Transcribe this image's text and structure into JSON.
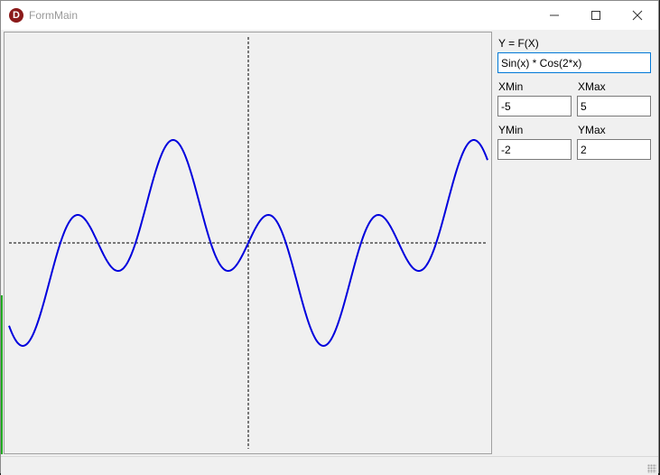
{
  "window": {
    "title": "FormMain",
    "icon_glyph": "D",
    "controls": [
      "minimize-icon",
      "maximize-icon",
      "close-icon"
    ]
  },
  "form": {
    "function_label": "Y = F(X)",
    "function_value": "Sin(x) * Cos(2*x)",
    "xmin_label": "XMin",
    "xmin_value": "-5",
    "xmax_label": "XMax",
    "xmax_value": "5",
    "ymin_label": "YMin",
    "ymin_value": "-2",
    "ymax_label": "YMax",
    "ymax_value": "2"
  },
  "chart_data": {
    "type": "line",
    "expression": "Sin(x) * Cos(2*x)",
    "xlim": [
      -5,
      5
    ],
    "ylim": [
      -2,
      2
    ],
    "axes": "dashed lines through origin",
    "curve_color": "#0000dd"
  }
}
